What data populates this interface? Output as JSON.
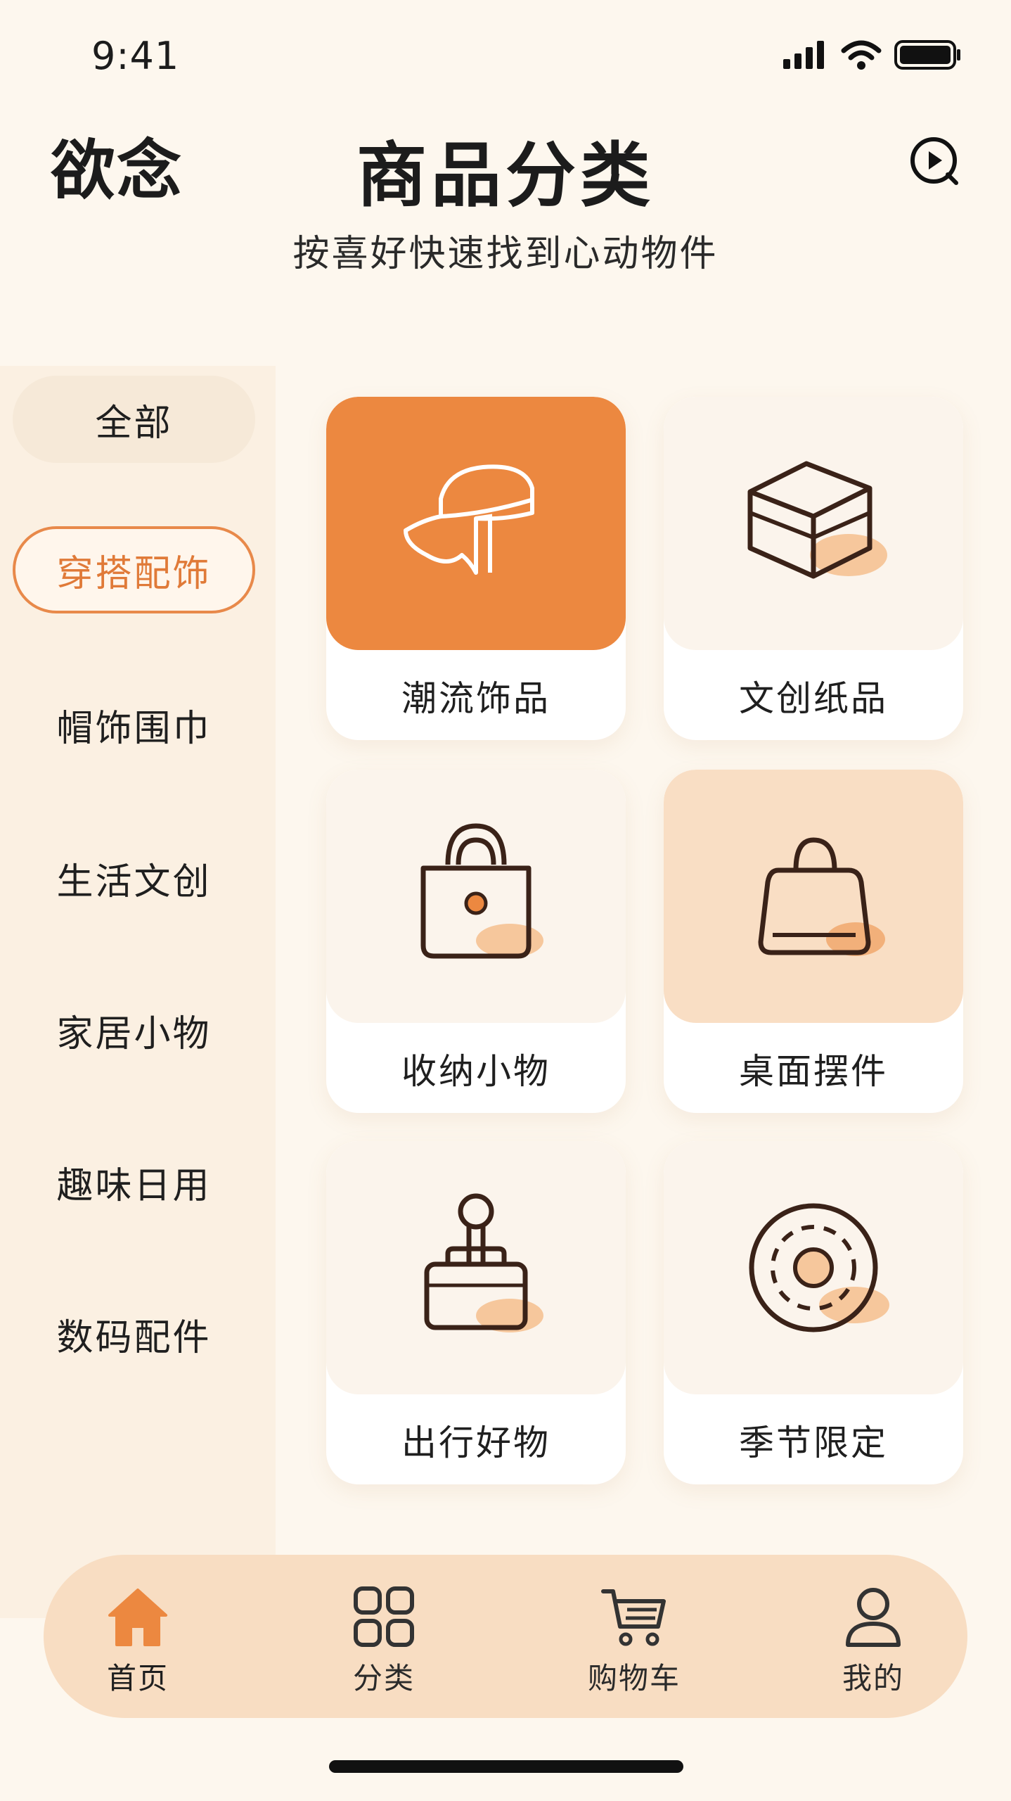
{
  "status_bar": {
    "time": "9:41",
    "icons": [
      "signal-icon",
      "wifi-icon",
      "battery-icon"
    ]
  },
  "header": {
    "brand": "欲念",
    "title": "商品分类",
    "subtitle": "按喜好快速找到心动物件",
    "action_icon": "play-circle-icon"
  },
  "sidebar": {
    "items": [
      {
        "label": "全部"
      },
      {
        "label": "穿搭配饰",
        "active": true
      },
      {
        "label": "帽饰围巾"
      },
      {
        "label": "生活文创"
      },
      {
        "label": "家居小物"
      },
      {
        "label": "趣味日用"
      },
      {
        "label": "数码配件"
      }
    ]
  },
  "grid": {
    "cards": [
      {
        "label": "潮流饰品",
        "icon": "cap-icon"
      },
      {
        "label": "文创纸品",
        "icon": "box-icon"
      },
      {
        "label": "收纳小物",
        "icon": "tote-bag-icon"
      },
      {
        "label": "桌面摆件",
        "icon": "handbag-icon"
      },
      {
        "label": "出行好物",
        "icon": "luggage-icon"
      },
      {
        "label": "季节限定",
        "icon": "target-icon"
      }
    ]
  },
  "bottom_nav": {
    "items": [
      {
        "label": "首页",
        "icon": "home-icon",
        "active": true
      },
      {
        "label": "分类",
        "icon": "grid-icon"
      },
      {
        "label": "购物车",
        "icon": "cart-icon"
      },
      {
        "label": "我的",
        "icon": "user-icon"
      }
    ]
  },
  "colors": {
    "accent": "#EC8840",
    "accent_text": "#E07A38",
    "background": "#FDF7EE",
    "nav_bg": "#F8DDC2",
    "ink": "#3A2218"
  }
}
